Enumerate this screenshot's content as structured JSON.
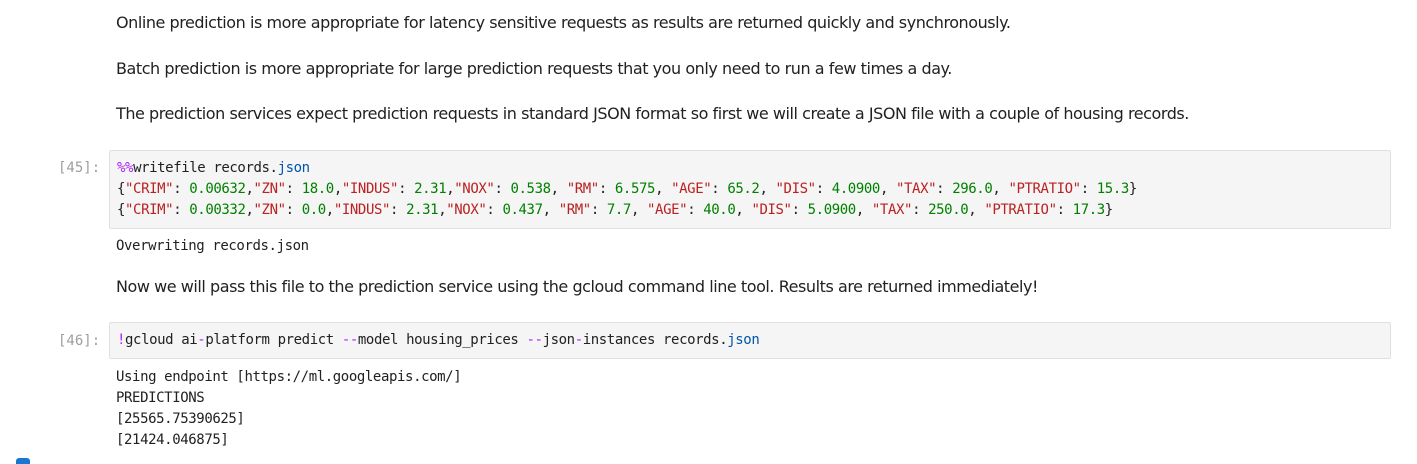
{
  "markdown": {
    "p1": "Online prediction is more appropriate for latency sensitive requests as results are returned quickly and synchronously.",
    "p2": "Batch prediction is more appropriate for large prediction requests that you only need to run a few times a day.",
    "p3": "The prediction services expect prediction requests in standard JSON format so first we will create a JSON file with a couple of housing records.",
    "p4": "Now we will pass this file to the prediction service using the gcloud command line tool. Results are returned immediately!"
  },
  "cells": {
    "cell45": {
      "prompt": "[45]:",
      "magic": "%%",
      "command": "writefile records.",
      "ext": "json",
      "record1": {
        "CRIM": "0.00632",
        "ZN": "18.0",
        "INDUS": "2.31",
        "NOX": "0.538",
        "RM": "6.575",
        "AGE": "65.2",
        "DIS": "4.0900",
        "TAX": "296.0",
        "PTRATIO": "15.3"
      },
      "record2": {
        "CRIM": "0.00332",
        "ZN": "0.0",
        "INDUS": "2.31",
        "NOX": "0.437",
        "RM": "7.7",
        "AGE": "40.0",
        "DIS": "5.0900",
        "TAX": "250.0",
        "PTRATIO": "17.3"
      },
      "output": "Overwriting records.json"
    },
    "cell46": {
      "prompt": "[46]:",
      "bang": "!",
      "gcloud": "gcloud ai",
      "dash1": "-",
      "platform": "platform predict ",
      "flag1": "--",
      "model": "model housing_prices ",
      "flag2": "--",
      "json1": "json",
      "dash2": "-",
      "instances": "instances records.",
      "ext": "json",
      "output_lines": [
        "Using endpoint [https://ml.googleapis.com/]",
        "PREDICTIONS",
        "[25565.75390625]",
        "[21424.046875]"
      ]
    }
  },
  "colors": {
    "magic": "#aa22ff",
    "string": "#ba2121",
    "number": "#008000",
    "prompt": "#9e9e9e",
    "cell_bg": "#f5f5f5"
  }
}
